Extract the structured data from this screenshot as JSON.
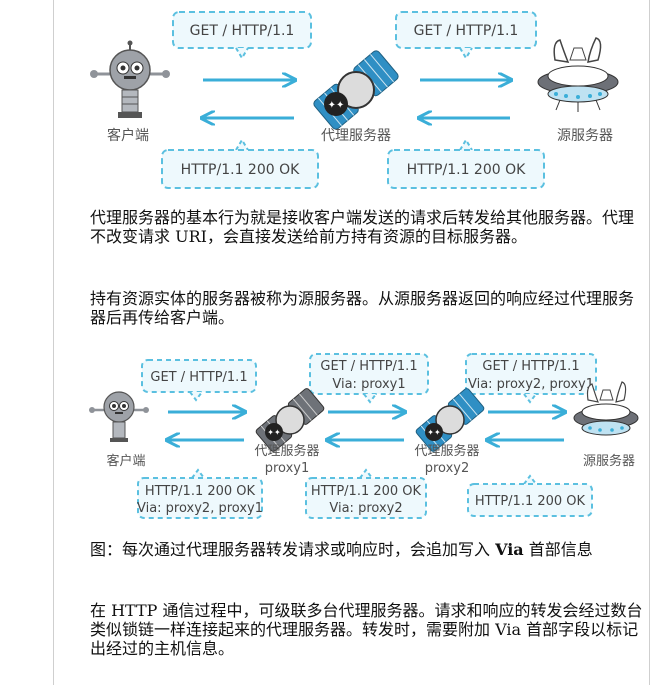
{
  "diagram1": {
    "request_top_left": "GET / HTTP/1.1",
    "request_top_right": "GET / HTTP/1.1",
    "response_bottom_left": "HTTP/1.1 200 OK",
    "response_bottom_right": "HTTP/1.1 200 OK",
    "client_label": "客户端",
    "proxy_label": "代理服务器",
    "origin_label": "源服务器"
  },
  "paragraph1": "代理服务器的基本行为就是接收客户端发送的请求后转发给其他服务器。代理不改变请求 URI，会直接发送给前方持有资源的目标服务器。",
  "paragraph2": "持有资源实体的服务器被称为源服务器。从源服务器返回的响应经过代理服务器后再传给客户端。",
  "diagram2": {
    "req1": "GET / HTTP/1.1",
    "req2_line1": "GET / HTTP/1.1",
    "req2_line2": "Via: proxy1",
    "req3_line1": "GET / HTTP/1.1",
    "req3_line2": "Via: proxy2, proxy1",
    "res1_line1": "HTTP/1.1 200 OK",
    "res1_line2": "Via: proxy2, proxy1",
    "res2_line1": "HTTP/1.1 200 OK",
    "res2_line2": "Via: proxy2",
    "res3": "HTTP/1.1 200 OK",
    "client_label": "客户端",
    "proxy1_label_line1": "代理服务器",
    "proxy1_label_line2": "proxy1",
    "proxy2_label_line1": "代理服务器",
    "proxy2_label_line2": "proxy2",
    "origin_label": "源服务器"
  },
  "caption_prefix": "图：每次通过代理服务器转发请求或响应时，会追加写入 ",
  "caption_bold": "Via",
  "caption_suffix": " 首部信息",
  "paragraph3": "在 HTTP 通信过程中，可级联多台代理服务器。请求和响应的转发会经过数台类似锁链一样连接起来的代理服务器。转发时，需要附加 Via 首部字段以标记出经过的主机信息。",
  "colors": {
    "arrow": "#3aaed8",
    "bubble_border": "#5bc0e0",
    "bubble_fill": "#eef9fd",
    "robot": "#8f9399",
    "ufo": "#6d7077"
  }
}
